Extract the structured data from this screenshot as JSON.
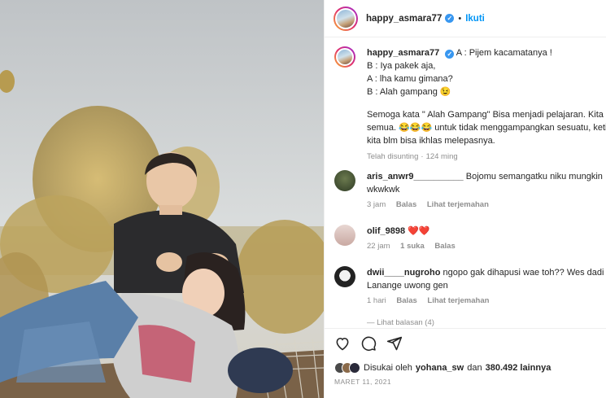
{
  "post": {
    "username": "happy_asmara77",
    "verified_mark": "✓",
    "separator": "•",
    "follow_label": "Ikuti"
  },
  "caption": {
    "username": "happy_asmara77",
    "lines": [
      "A : Pijem kacamatanya !",
      "B : Iya pakek aja,",
      "A : lha kamu gimana?",
      "B : Alah gampang 😉",
      "Semoga kata \" Alah Gampang\" Bisa menjadi pelajaran. Kita",
      "semua. 😂😂😂 untuk tidak menggampangkan sesuatu, ketika",
      "kita blm bisa ikhlas melepasnya."
    ],
    "edited": "Telah disunting",
    "time": "124 ming",
    "dot": "·"
  },
  "comments": [
    {
      "user": "aris_anwr9__________",
      "text1": "Bojomu semangatku niku mungkin",
      "text2": "wkwkwk",
      "time": "3 jam",
      "reply": "Balas",
      "translate": "Lihat terjemahan"
    },
    {
      "user": "olif_9898",
      "text1": "❤️❤️",
      "time": "22 jam",
      "likes": "1 suka",
      "reply": "Balas"
    },
    {
      "user": "dwii____nugroho",
      "text1": "ngopo gak dihapusi wae toh?? Wes dadi",
      "text2": "Lanange uwong gen",
      "time": "1 hari",
      "reply": "Balas",
      "translate": "Lihat terjemahan"
    }
  ],
  "view_replies": "— Lihat balasan (4)",
  "likes": {
    "prefix": "Disukai oleh",
    "user": "yohana_sw",
    "conj": "dan",
    "count": "380.492 lainnya"
  },
  "date": "MARET 11, 2021",
  "icons": [
    "heart-icon",
    "comment-icon",
    "share-icon"
  ]
}
